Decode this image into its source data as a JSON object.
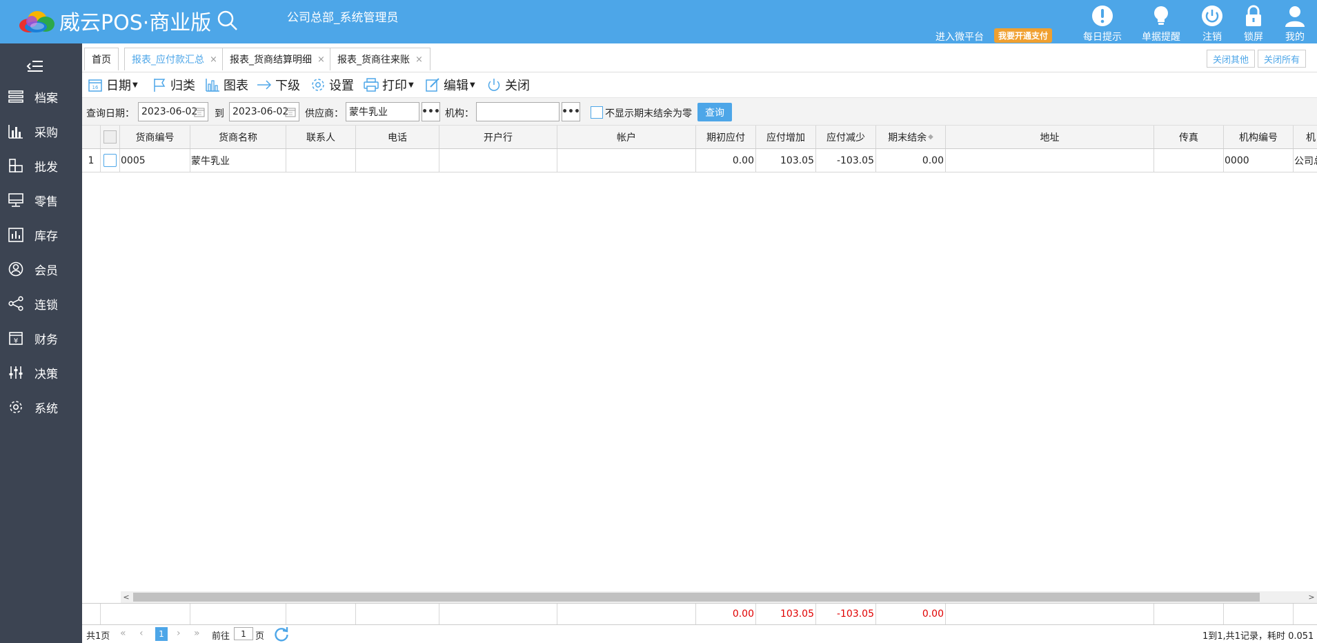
{
  "header": {
    "app_title": "威云POS·商业版",
    "user": "公司总部_系统管理员",
    "wechat_link": "进入微平台",
    "pay_badge": "我要开通支付",
    "icons": [
      {
        "label": "每日提示",
        "icon": "exclamation-icon"
      },
      {
        "label": "单据提醒",
        "icon": "lightbulb-icon"
      },
      {
        "label": "注销",
        "icon": "power-icon"
      },
      {
        "label": "锁屏",
        "icon": "lock-icon"
      },
      {
        "label": "我的",
        "icon": "user-icon"
      }
    ]
  },
  "sidebar": {
    "items": [
      {
        "label": "档案",
        "icon": "list-icon"
      },
      {
        "label": "采购",
        "icon": "bar-chart-icon"
      },
      {
        "label": "批发",
        "icon": "boxes-icon"
      },
      {
        "label": "零售",
        "icon": "monitor-icon"
      },
      {
        "label": "库存",
        "icon": "stock-chart-icon"
      },
      {
        "label": "会员",
        "icon": "member-icon"
      },
      {
        "label": "连锁",
        "icon": "share-icon"
      },
      {
        "label": "财务",
        "icon": "yen-icon"
      },
      {
        "label": "决策",
        "icon": "sliders-icon"
      },
      {
        "label": "系统",
        "icon": "gear-icon"
      }
    ]
  },
  "tabs": [
    {
      "label": "首页",
      "closable": false,
      "active": false
    },
    {
      "label": "报表_应付款汇总",
      "closable": true,
      "active": true
    },
    {
      "label": "报表_货商结算明细",
      "closable": true,
      "active": false
    },
    {
      "label": "报表_货商往来账",
      "closable": true,
      "active": false
    }
  ],
  "tab_actions": {
    "close_others": "关闭其他",
    "close_all": "关闭所有"
  },
  "toolbar": {
    "date": "日期",
    "category": "归类",
    "chart": "图表",
    "drilldown": "下级",
    "settings": "设置",
    "print": "打印",
    "edit": "编辑",
    "close": "关闭"
  },
  "query": {
    "date_label": "查询日期：",
    "date_from": "2023-06-02",
    "to_label": "到",
    "date_to": "2023-06-02",
    "supplier_label": "供应商：",
    "supplier_value": "蒙牛乳业",
    "org_label": "机构：",
    "org_value": "",
    "hide_zero_label": "不显示期末结余为零",
    "query_button": "查询"
  },
  "table": {
    "columns": [
      "货商编号",
      "货商名称",
      "联系人",
      "电话",
      "开户行",
      "帐户",
      "期初应付",
      "应付增加",
      "应付减少",
      "期末结余",
      "地址",
      "传真",
      "机构编号",
      "机"
    ],
    "rows": [
      {
        "index": "1",
        "code": "0005",
        "name": "蒙牛乳业",
        "contact": "",
        "phone": "",
        "bank": "",
        "account": "",
        "opening": "0.00",
        "increase": "103.05",
        "decrease": "-103.05",
        "closing": "0.00",
        "address": "",
        "fax": "",
        "org_code": "0000",
        "org": "公司总"
      }
    ],
    "totals": {
      "opening": "0.00",
      "increase": "103.05",
      "decrease": "-103.05",
      "closing": "0.00"
    }
  },
  "pager": {
    "total_pages": "共1页",
    "current": "1",
    "goto_label": "前往",
    "goto_value": "1",
    "page_suffix": "页",
    "summary": "1到1,共1记录，耗时 0.051"
  },
  "colors": {
    "header": "#4da6e8",
    "sidebar": "#3c4452",
    "pay_badge": "#f0a030",
    "totals": "#e00000"
  }
}
